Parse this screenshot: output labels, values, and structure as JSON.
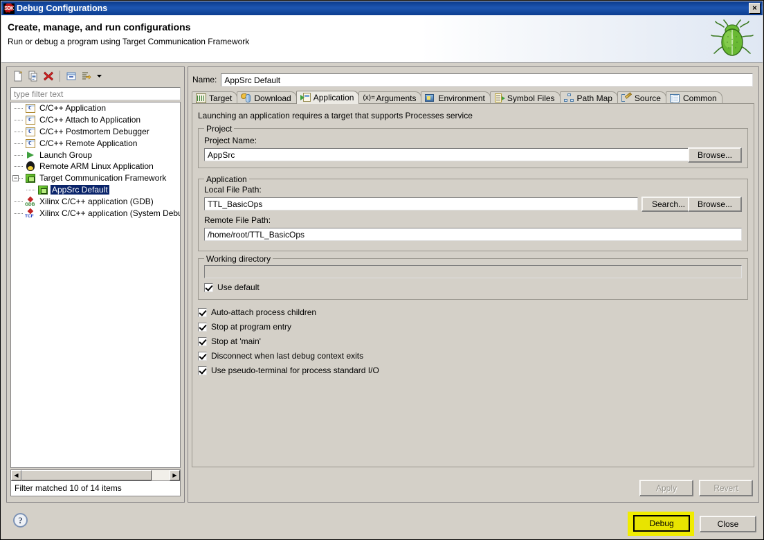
{
  "window": {
    "title": "Debug Configurations",
    "app_icon": "sdk-icon",
    "close_label": "×"
  },
  "banner": {
    "title": "Create, manage, and run configurations",
    "subtitle": "Run or debug a program using Target Communication Framework",
    "icon": "green-bug-icon"
  },
  "tree_toolbar": {
    "buttons": [
      {
        "name": "new-launch-configuration",
        "icon": "new-document-icon"
      },
      {
        "name": "duplicate-launch-configuration",
        "icon": "copy-icon"
      },
      {
        "name": "delete-launch-configuration",
        "icon": "red-x-icon"
      },
      {
        "name": "collapse-all",
        "icon": "collapse-all-icon"
      },
      {
        "name": "filter-launch-configurations",
        "icon": "filter-icon"
      },
      {
        "name": "filter-menu-dropdown",
        "icon": "chevron-down-icon"
      }
    ]
  },
  "filter": {
    "placeholder": "type filter text",
    "value": ""
  },
  "tree": {
    "items": [
      {
        "label": "C/C++ Application",
        "icon": "c-file-icon",
        "level": 0,
        "selected": false
      },
      {
        "label": "C/C++ Attach to Application",
        "icon": "c-file-icon",
        "level": 0,
        "selected": false
      },
      {
        "label": "C/C++ Postmortem Debugger",
        "icon": "c-file-icon",
        "level": 0,
        "selected": false
      },
      {
        "label": "C/C++ Remote Application",
        "icon": "c-file-icon",
        "level": 0,
        "selected": false
      },
      {
        "label": "Launch Group",
        "icon": "green-play-icon",
        "level": 0,
        "selected": false
      },
      {
        "label": "Remote ARM Linux Application",
        "icon": "tux-icon",
        "level": 0,
        "selected": false
      },
      {
        "label": "Target Communication Framework",
        "icon": "tcf-icon",
        "level": 0,
        "selected": false,
        "expanded": true
      },
      {
        "label": "AppSrc Default",
        "icon": "tcf-icon",
        "level": 1,
        "selected": true
      },
      {
        "label": "Xilinx C/C++ application (GDB)",
        "icon": "xilinx-gdb-icon",
        "level": 0,
        "selected": false
      },
      {
        "label": "Xilinx C/C++ application (System Debugger)",
        "icon": "xilinx-tcf-icon",
        "level": 0,
        "selected": false
      }
    ],
    "status": "Filter matched 10 of 14 items"
  },
  "form": {
    "name_label": "Name:",
    "name_value": "AppSrc Default"
  },
  "tabs": [
    {
      "label": "Target",
      "icon": "target-board-icon",
      "active": false
    },
    {
      "label": "Download",
      "icon": "download-icon",
      "active": false
    },
    {
      "label": "Application",
      "icon": "application-icon",
      "active": true
    },
    {
      "label": "Arguments",
      "icon": "arguments-icon",
      "active": false
    },
    {
      "label": "Environment",
      "icon": "environment-icon",
      "active": false
    },
    {
      "label": "Symbol Files",
      "icon": "symbol-files-icon",
      "active": false
    },
    {
      "label": "Path Map",
      "icon": "path-map-icon",
      "active": false
    },
    {
      "label": "Source",
      "icon": "source-icon",
      "active": false
    },
    {
      "label": "Common",
      "icon": "common-icon",
      "active": false
    }
  ],
  "application_tab": {
    "description": "Launching an application requires a target that supports Processes service",
    "project_group": {
      "legend": "Project",
      "name_label": "Project Name:",
      "name_value": "AppSrc",
      "browse_label": "Browse..."
    },
    "application_group": {
      "legend": "Application",
      "local_label": "Local File Path:",
      "local_value": "TTL_BasicOps",
      "search_label": "Search...",
      "browse_label": "Browse...",
      "remote_label": "Remote File Path:",
      "remote_value": "/home/root/TTL_BasicOps"
    },
    "working_directory_group": {
      "legend": "Working directory",
      "value": "",
      "use_default_label": "Use default",
      "use_default_checked": true
    },
    "options": [
      {
        "label": "Auto-attach process children",
        "checked": true
      },
      {
        "label": "Stop at program entry",
        "checked": true
      },
      {
        "label": "Stop at 'main'",
        "checked": true
      },
      {
        "label": "Disconnect when last debug context exits",
        "checked": true
      },
      {
        "label": "Use pseudo-terminal for process standard I/O",
        "checked": true
      }
    ],
    "apply_label": "Apply",
    "apply_enabled": false,
    "revert_label": "Revert",
    "revert_enabled": false
  },
  "footer": {
    "help_label": "?",
    "debug_label": "Debug",
    "debug_highlighted": true,
    "close_label": "Close"
  },
  "colors": {
    "dialog_background": "#d4d0c8",
    "titlebar": "#0b3b8c",
    "selection": "#0a246a",
    "highlight_yellow": "#f0ec00",
    "debug_button": "#e8e400",
    "field_background": "#ffffff"
  }
}
